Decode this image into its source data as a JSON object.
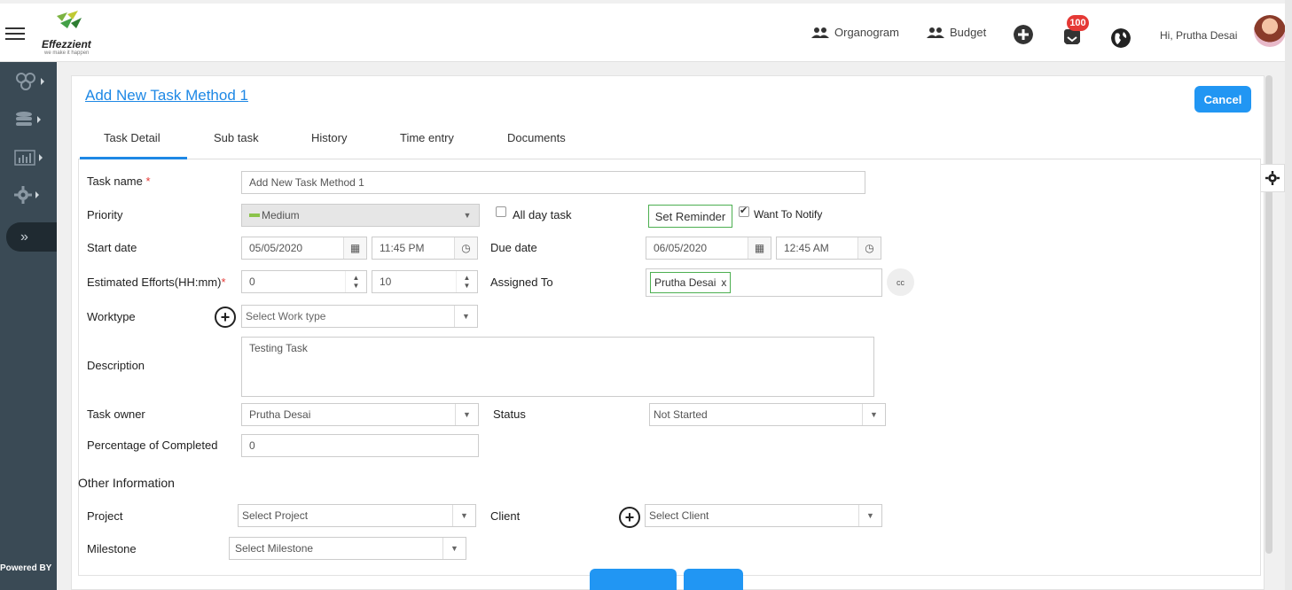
{
  "app": {
    "logo_text": "Effezzient",
    "logo_tagline": "we make it happen"
  },
  "header": {
    "organogram_label": "Organogram",
    "budget_label": "Budget",
    "notification_count": "100",
    "greeting": "Hi, Prutha Desai"
  },
  "sidebar": {
    "items": [
      {
        "icon": "modules-icon"
      },
      {
        "icon": "database-icon"
      },
      {
        "icon": "chart-icon"
      },
      {
        "icon": "gear-icon"
      }
    ],
    "expand_glyph": "»",
    "powered_by": "Powered BY"
  },
  "page": {
    "title": "Add New Task Method 1",
    "cancel_label": "Cancel"
  },
  "tabs": [
    {
      "label": "Task Detail",
      "active": true
    },
    {
      "label": "Sub task"
    },
    {
      "label": "History"
    },
    {
      "label": "Time entry"
    },
    {
      "label": "Documents"
    }
  ],
  "form": {
    "task_name": {
      "label": "Task name",
      "required_mark": "*",
      "value": "Add New Task Method 1"
    },
    "priority": {
      "label": "Priority",
      "value": "Medium",
      "color": "#8bc34a"
    },
    "all_day": {
      "label": "All day task",
      "checked": false
    },
    "set_reminder_label": "Set Reminder",
    "want_to_notify": {
      "label": "Want To Notify",
      "checked": true
    },
    "start_date": {
      "label": "Start date",
      "date": "05/05/2020",
      "time": "11:45 PM"
    },
    "due_date": {
      "label": "Due date",
      "date": "06/05/2020",
      "time": "12:45 AM"
    },
    "estimated_efforts": {
      "label": "Estimated Efforts(HH:mm)",
      "required_mark": "*",
      "hours": "0",
      "minutes": "10"
    },
    "assigned_to": {
      "label": "Assigned To",
      "tag": "Prutha Desai",
      "remove_glyph": "x",
      "cc_label": "cc"
    },
    "worktype": {
      "label": "Worktype",
      "placeholder": "Select Work type"
    },
    "description": {
      "label": "Description",
      "value": "Testing Task"
    },
    "task_owner": {
      "label": "Task owner",
      "value": "Prutha Desai"
    },
    "status": {
      "label": "Status",
      "value": "Not Started"
    },
    "percentage": {
      "label": "Percentage of Completed",
      "value": "0"
    },
    "other_info_title": "Other Information",
    "project": {
      "label": "Project",
      "placeholder": "Select Project"
    },
    "client": {
      "label": "Client",
      "placeholder": "Select Client"
    },
    "milestone": {
      "label": "Milestone",
      "placeholder": "Select Milestone"
    }
  },
  "colors": {
    "primary": "#2196f3",
    "sidebar": "#3a4a55",
    "accent_green": "#4caf50",
    "badge": "#e53935"
  }
}
